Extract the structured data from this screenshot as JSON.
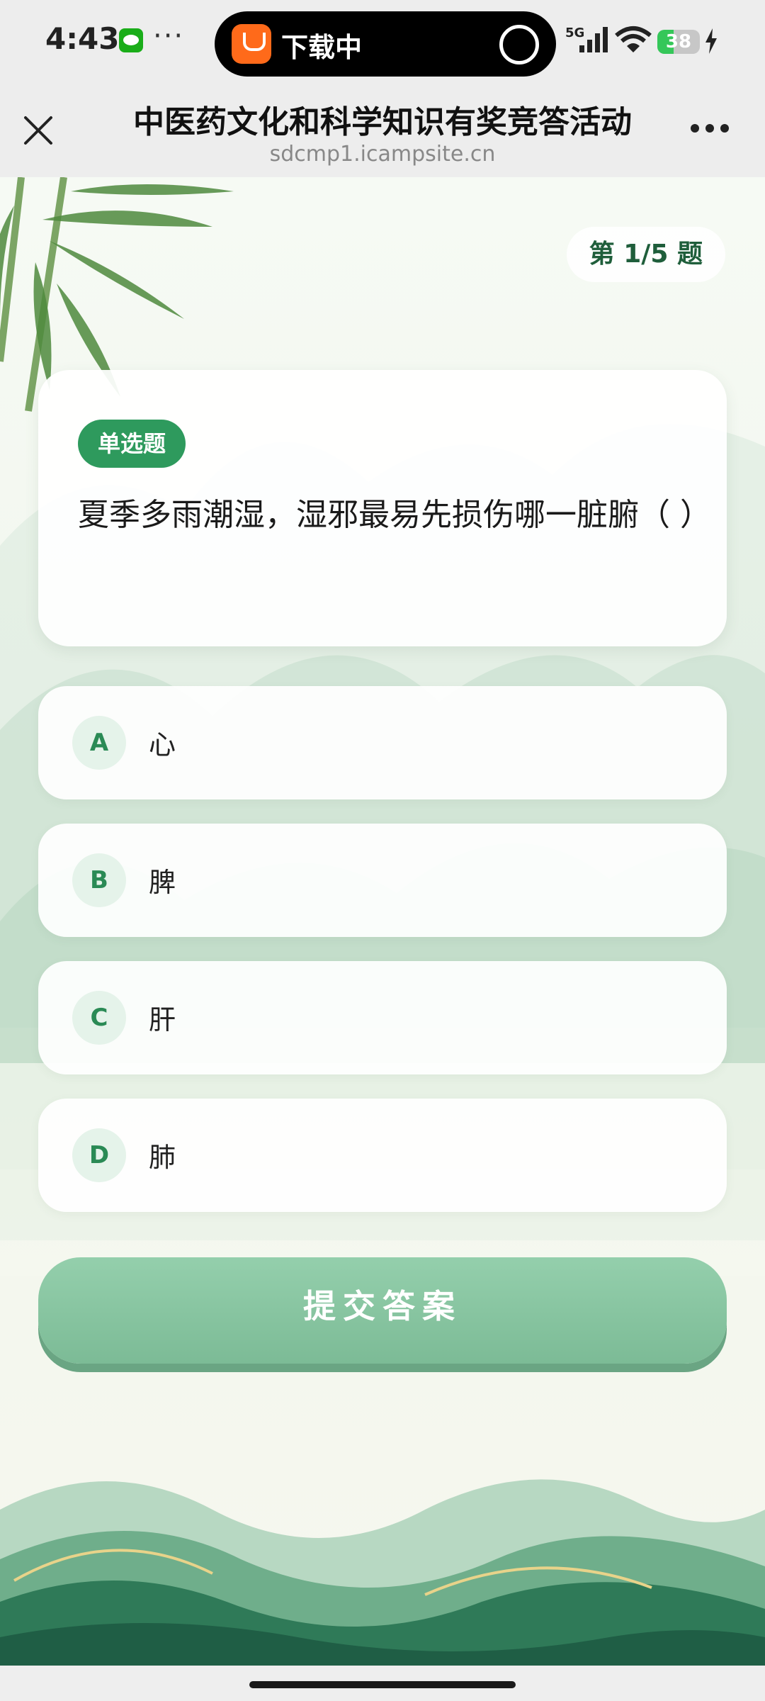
{
  "status_bar": {
    "time": "4:43",
    "dots": "···",
    "pill_text": "下载中",
    "network": "5G",
    "battery": "38",
    "battery_level": 0.38
  },
  "nav": {
    "title": "中医药文化和科学知识有奖竞答活动",
    "subtitle": "sdcmp1.icampsite.cn"
  },
  "quiz": {
    "progress": "第 1/5 题",
    "type_badge": "单选题",
    "question": "夏季多雨潮湿，湿邪最易先损伤哪一脏腑（ ）",
    "options": [
      {
        "letter": "A",
        "text": "心"
      },
      {
        "letter": "B",
        "text": "脾"
      },
      {
        "letter": "C",
        "text": "肝"
      },
      {
        "letter": "D",
        "text": "肺"
      }
    ],
    "submit_label": "提交答案"
  },
  "colors": {
    "accent": "#2e9a5d",
    "button": "#86c4a0",
    "text_dark": "#1f5e3b"
  }
}
